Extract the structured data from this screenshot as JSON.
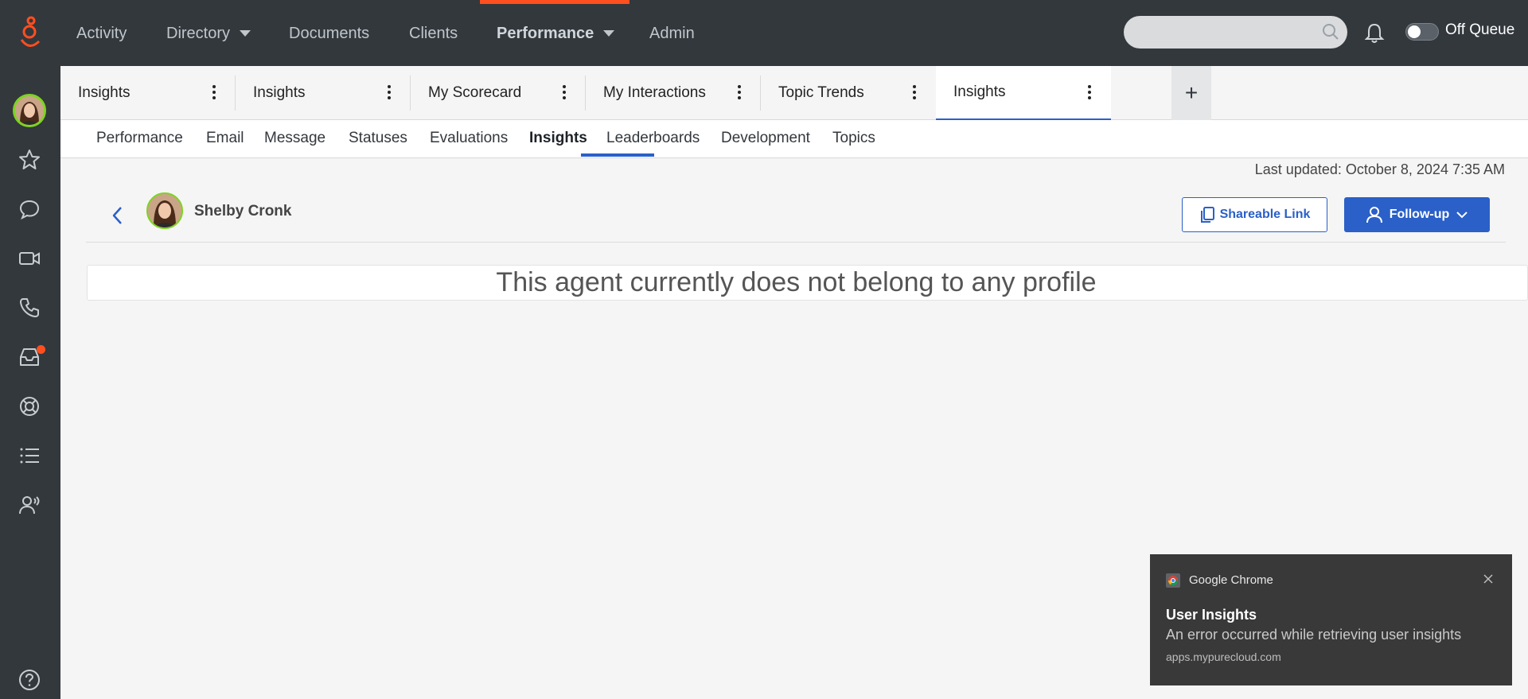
{
  "topnav": {
    "items": [
      {
        "label": "Activity"
      },
      {
        "label": "Directory"
      },
      {
        "label": "Documents"
      },
      {
        "label": "Clients"
      },
      {
        "label": "Performance"
      },
      {
        "label": "Admin"
      }
    ],
    "active_item": "Performance",
    "queue_status": "Off Queue",
    "queue_toggle_on": false,
    "accent_color": "#ff4f1f"
  },
  "leftrail": {
    "icons": [
      "avatar",
      "star-icon",
      "chat-icon",
      "video-icon",
      "phone-icon",
      "inbox-icon",
      "lifebuoy-icon",
      "list-icon",
      "people-icon",
      "help-icon"
    ]
  },
  "tabs": [
    {
      "label": "Insights"
    },
    {
      "label": "Insights"
    },
    {
      "label": "My Scorecard"
    },
    {
      "label": "My Interactions"
    },
    {
      "label": "Topic Trends"
    },
    {
      "label": "Insights"
    }
  ],
  "active_tab_index": 5,
  "add_tab_label": "+",
  "subnav": {
    "items": [
      {
        "label": "Performance"
      },
      {
        "label": "Email"
      },
      {
        "label": "Message"
      },
      {
        "label": "Statuses"
      },
      {
        "label": "Evaluations"
      },
      {
        "label": "Insights"
      },
      {
        "label": "Leaderboards"
      },
      {
        "label": "Development"
      },
      {
        "label": "Topics"
      }
    ],
    "active_item": "Insights"
  },
  "content": {
    "last_updated": "Last updated: October 8, 2024 7:35 AM",
    "agent_name": "Shelby Cronk",
    "share_button": "Shareable Link",
    "follow_button": "Follow-up",
    "empty_message": "This agent currently does not belong to any profile"
  },
  "notification": {
    "app": "Google Chrome",
    "title": "User Insights",
    "body": "An error occurred while retrieving user insights",
    "source": "apps.mypurecloud.com"
  },
  "colors": {
    "primary": "#2a60c8",
    "nav_bg": "#33383d",
    "accent": "#ff4f1f",
    "avatar_ring": "#7ed321"
  }
}
